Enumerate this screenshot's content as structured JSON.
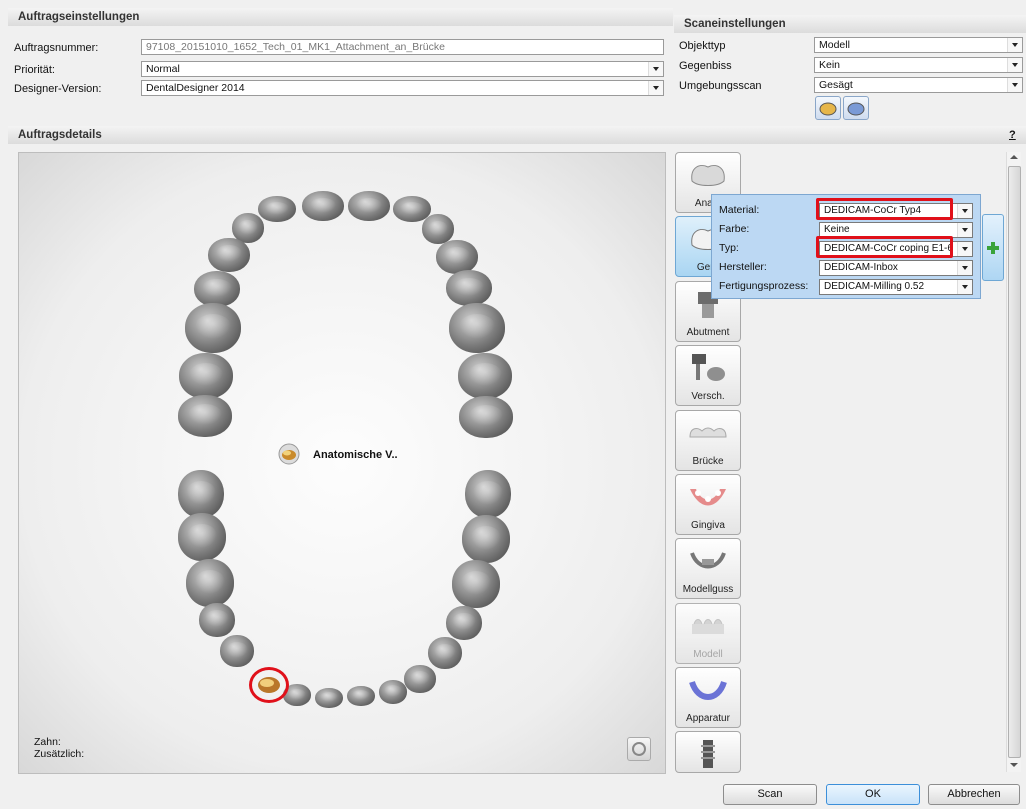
{
  "order_settings": {
    "title": "Auftragseinstellungen",
    "order_number_label": "Auftragsnummer:",
    "order_number_value": "97108_20151010_1652_Tech_01_MK1_Attachment_an_Brücke",
    "priority_label": "Priorität:",
    "priority_value": "Normal",
    "designer_version_label": "Designer-Version:",
    "designer_version_value": "DentalDesigner 2014"
  },
  "scan_settings": {
    "title": "Scaneinstellungen",
    "object_type_label": "Objekttyp",
    "object_type_value": "Modell",
    "antagonist_label": "Gegenbiss",
    "antagonist_value": "Kein",
    "environment_scan_label": "Umgebungsscan",
    "environment_scan_value": "Gesägt"
  },
  "order_details": {
    "title": "Auftragsdetails",
    "help": "?",
    "hover_label": "Anatomische V..",
    "tooth_label": "Zahn:",
    "additional_label": "Zusätzlich:"
  },
  "categories": [
    {
      "label": "Anato",
      "icon": "anatomy-crown-icon"
    },
    {
      "label": "Gerü",
      "icon": "framework-icon"
    },
    {
      "label": "Abutment",
      "icon": "abutment-icon"
    },
    {
      "label": "Versch.",
      "icon": "attachment-icon"
    },
    {
      "label": "Brücke",
      "icon": "bridge-icon"
    },
    {
      "label": "Gingiva",
      "icon": "gingiva-icon"
    },
    {
      "label": "Modellguss",
      "icon": "partial-framework-icon"
    },
    {
      "label": "Modell",
      "icon": "model-icon"
    },
    {
      "label": "Apparatur",
      "icon": "appliance-icon"
    },
    {
      "label": "",
      "icon": "implant-icon"
    }
  ],
  "material_popup": {
    "material_label": "Material:",
    "material_value": "DEDICAM-CoCr Typ4",
    "color_label": "Farbe:",
    "color_value": "Keine",
    "type_label": "Typ:",
    "type_value": "DEDICAM-CoCr coping E1-6",
    "manufacturer_label": "Hersteller:",
    "manufacturer_value": "DEDICAM-Inbox",
    "process_label": "Fertigungsprozess:",
    "process_value": "DEDICAM-Milling 0.52",
    "add_icon": "plus-icon"
  },
  "buttons": {
    "scan": "Scan",
    "ok": "OK",
    "cancel": "Abbrechen"
  },
  "colors": {
    "highlight": "#e0101a",
    "popup_bg": "#bcd8f3",
    "add_green": "#3aa33a"
  }
}
